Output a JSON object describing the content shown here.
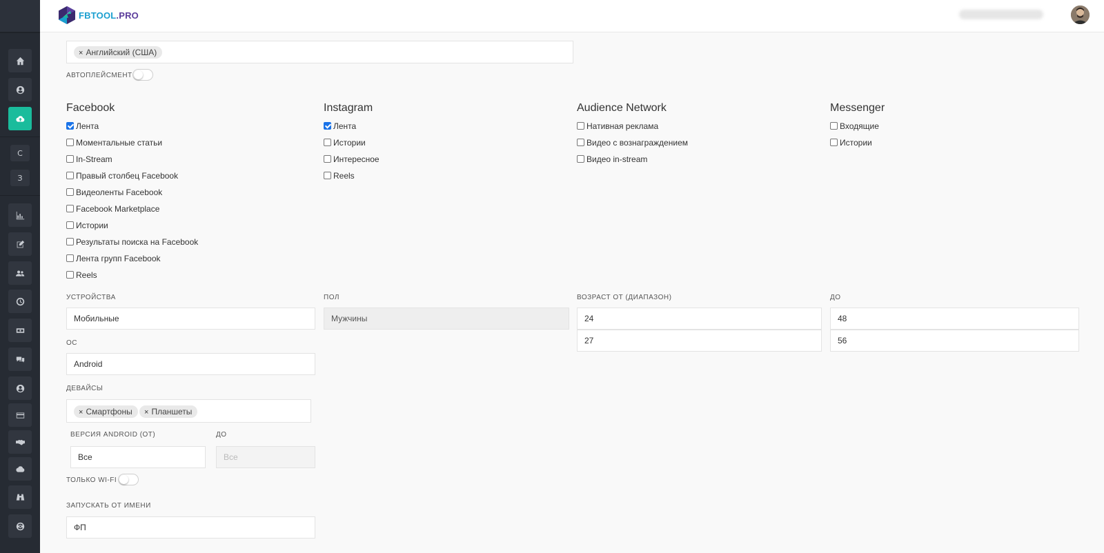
{
  "brand": {
    "logo_part1": "FBTOOL",
    "logo_part2": ".PRO",
    "primary": "#1abc9c",
    "sidebar_bg": "#262b33"
  },
  "sidebar": {
    "icons": [
      "home-icon",
      "user-circle-icon",
      "cloud-upload-icon",
      "chart-icon",
      "edit-icon",
      "users-icon",
      "clock-icon",
      "money-icon",
      "comments-icon",
      "user-icon",
      "credit-card-icon",
      "handshake-icon",
      "cloud-icon",
      "binoculars-icon",
      "support-icon"
    ],
    "letters": [
      "С",
      "З"
    ]
  },
  "languages": {
    "tags": [
      "Английский (США)"
    ]
  },
  "autoplacement": {
    "label": "АВТОПЛЕЙСМЕНТ",
    "enabled": false
  },
  "placements": {
    "facebook": {
      "title": "Facebook",
      "items": [
        {
          "label": "Лента",
          "checked": true
        },
        {
          "label": "Моментальные статьи",
          "checked": false
        },
        {
          "label": "In-Stream",
          "checked": false
        },
        {
          "label": "Правый столбец Facebook",
          "checked": false
        },
        {
          "label": "Видеоленты Facebook",
          "checked": false
        },
        {
          "label": "Facebook Marketplace",
          "checked": false
        },
        {
          "label": "Истории",
          "checked": false
        },
        {
          "label": "Результаты поиска на Facebook",
          "checked": false
        },
        {
          "label": "Лента групп Facebook",
          "checked": false
        },
        {
          "label": "Reels",
          "checked": false
        }
      ]
    },
    "instagram": {
      "title": "Instagram",
      "items": [
        {
          "label": "Лента",
          "checked": true
        },
        {
          "label": "Истории",
          "checked": false
        },
        {
          "label": "Интересное",
          "checked": false
        },
        {
          "label": "Reels",
          "checked": false
        }
      ]
    },
    "audience_network": {
      "title": "Audience Network",
      "items": [
        {
          "label": "Нативная реклама",
          "checked": false
        },
        {
          "label": "Видео с вознаграждением",
          "checked": false
        },
        {
          "label": "Видео in-stream",
          "checked": false
        }
      ]
    },
    "messenger": {
      "title": "Messenger",
      "items": [
        {
          "label": "Входящие",
          "checked": false
        },
        {
          "label": "Истории",
          "checked": false
        }
      ]
    }
  },
  "devices": {
    "label": "УСТРОЙСТВА",
    "value": "Мобильные"
  },
  "gender": {
    "label": "ПОЛ",
    "value": "Мужчины"
  },
  "age_from": {
    "label": "ВОЗРАСТ ОТ (ДИАПАЗОН)",
    "values": [
      "24",
      "27"
    ]
  },
  "age_to": {
    "label": "ДО",
    "values": [
      "48",
      "56"
    ]
  },
  "os": {
    "label": "ОС",
    "value": "Android"
  },
  "device_types": {
    "label": "ДЕВАЙСЫ",
    "tags": [
      "Смартфоны",
      "Планшеты"
    ]
  },
  "android_version": {
    "from_label": "ВЕРСИЯ ANDROID (ОТ)",
    "from_value": "Все",
    "to_label": "ДО",
    "to_placeholder": "Все"
  },
  "wifi_only": {
    "label": "ТОЛЬКО WI-FI",
    "enabled": false
  },
  "run_as": {
    "label": "ЗАПУСКАТЬ ОТ ИМЕНИ",
    "value": "ФП"
  }
}
